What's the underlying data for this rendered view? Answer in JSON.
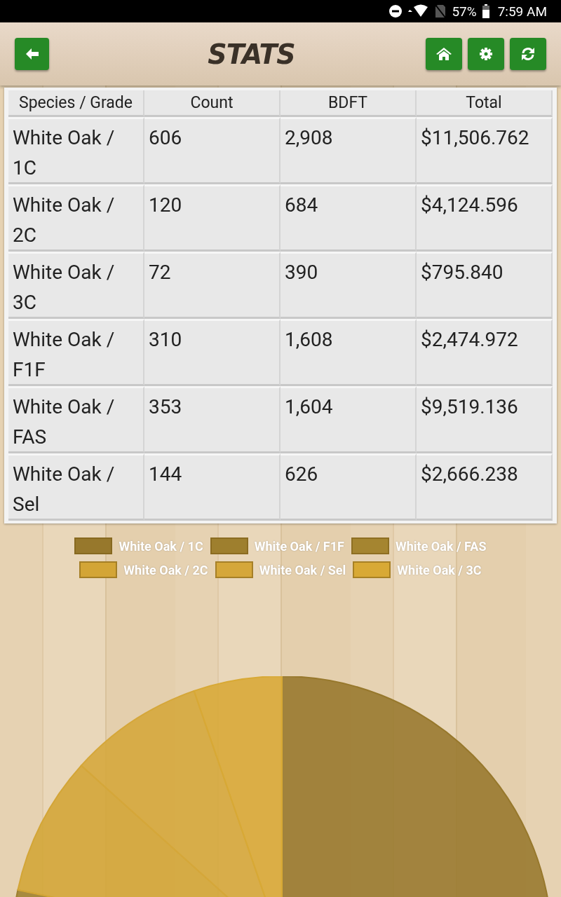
{
  "status_bar": {
    "battery": "57%",
    "time": "7:59 AM"
  },
  "header": {
    "title": "STATS"
  },
  "table": {
    "columns": [
      "Species / Grade",
      "Count",
      "BDFT",
      "Total"
    ],
    "rows": [
      [
        "White Oak / 1C",
        "606",
        "2,908",
        "$11,506.762"
      ],
      [
        "White Oak / 2C",
        "120",
        "684",
        "$4,124.596"
      ],
      [
        "White Oak / 3C",
        "72",
        "390",
        "$795.840"
      ],
      [
        "White Oak / F1F",
        "310",
        "1,608",
        "$2,474.972"
      ],
      [
        "White Oak / FAS",
        "353",
        "1,604",
        "$9,519.136"
      ],
      [
        "White Oak / Sel",
        "144",
        "626",
        "$2,666.238"
      ]
    ]
  },
  "chart": {
    "legend": [
      {
        "label": "White Oak / 1C",
        "color": "#97782c"
      },
      {
        "label": "White Oak / F1F",
        "color": "#9e7f2e"
      },
      {
        "label": "White Oak / FAS",
        "color": "#a58530"
      },
      {
        "label": "White Oak / 2C",
        "color": "#d3a536"
      },
      {
        "label": "White Oak / Sel",
        "color": "#d5a73a"
      },
      {
        "label": "White Oak / 3C",
        "color": "#d8a935"
      }
    ]
  }
}
